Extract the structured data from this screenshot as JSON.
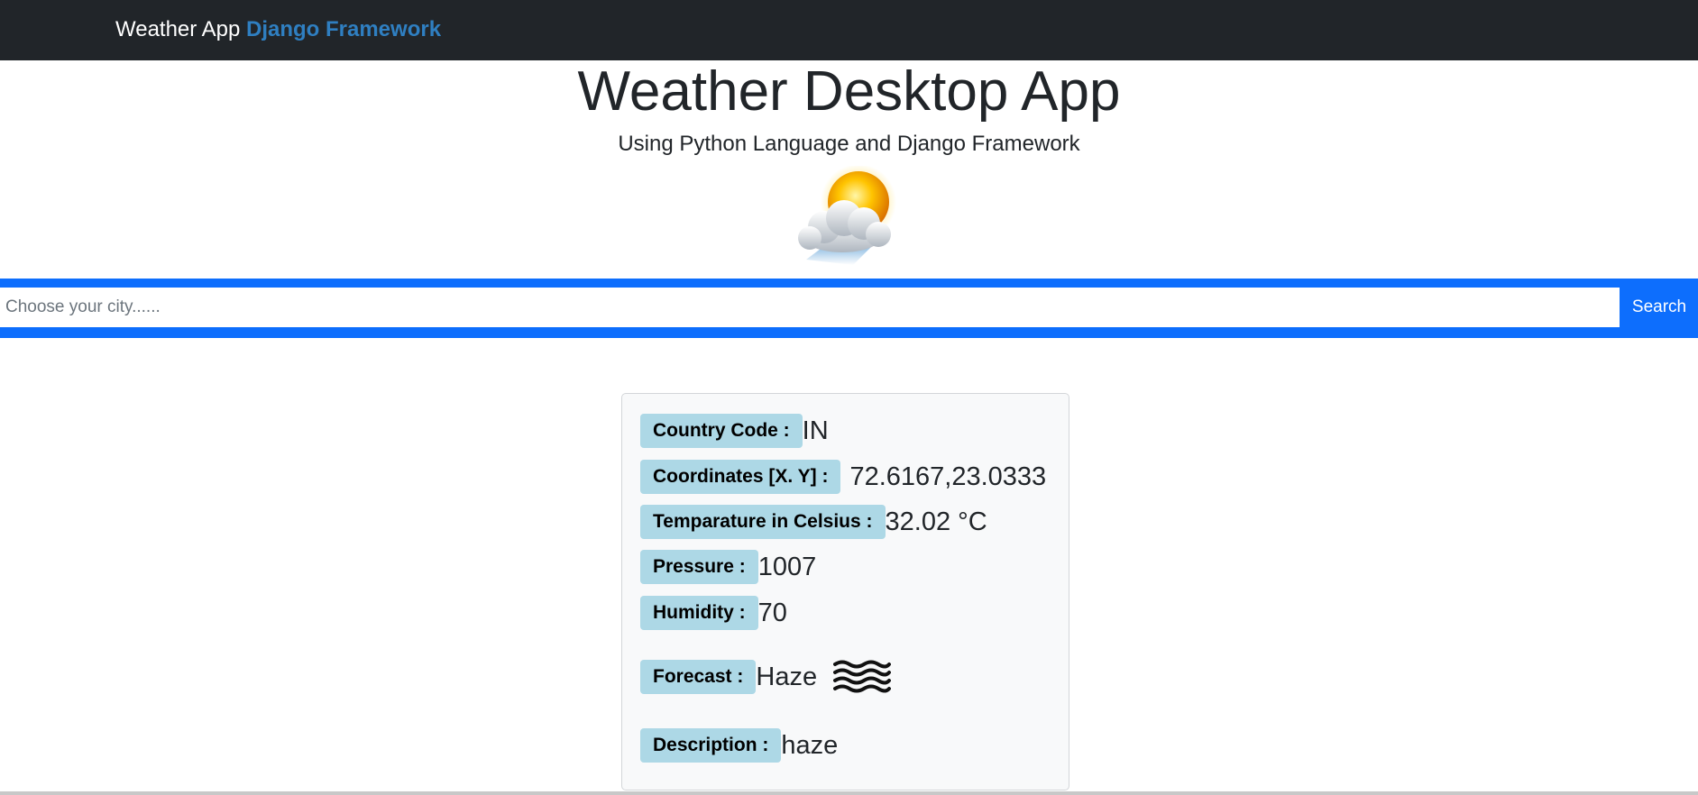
{
  "navbar": {
    "brand_plain": "Weather App",
    "brand_accent": "Django Framework"
  },
  "hero": {
    "title": "Weather Desktop App",
    "subtitle": "Using Python Language and Django Framework",
    "icon": "sun-behind-cloud-icon"
  },
  "search": {
    "placeholder": "Choose your city......",
    "value": "",
    "button_label": "Search"
  },
  "weather": {
    "country_code_label": "Country Code :",
    "country_code": "IN",
    "coordinates_label": "Coordinates [X. Y] :",
    "coordinates": "72.6167,23.0333",
    "temperature_label": "Temparature in Celsius :",
    "temperature": "32.02 °C",
    "pressure_label": "Pressure :",
    "pressure": "1007",
    "humidity_label": "Humidity :",
    "humidity": "70",
    "forecast_label": "Forecast :",
    "forecast": "Haze",
    "forecast_icon": "haze-icon",
    "description_label": "Description :",
    "description": "haze"
  },
  "colors": {
    "navbar_bg": "#212529",
    "brand_accent": "#2f7fc1",
    "primary": "#0d6efd",
    "label_bg": "#add8e6",
    "card_bg": "#f8f9fa"
  }
}
